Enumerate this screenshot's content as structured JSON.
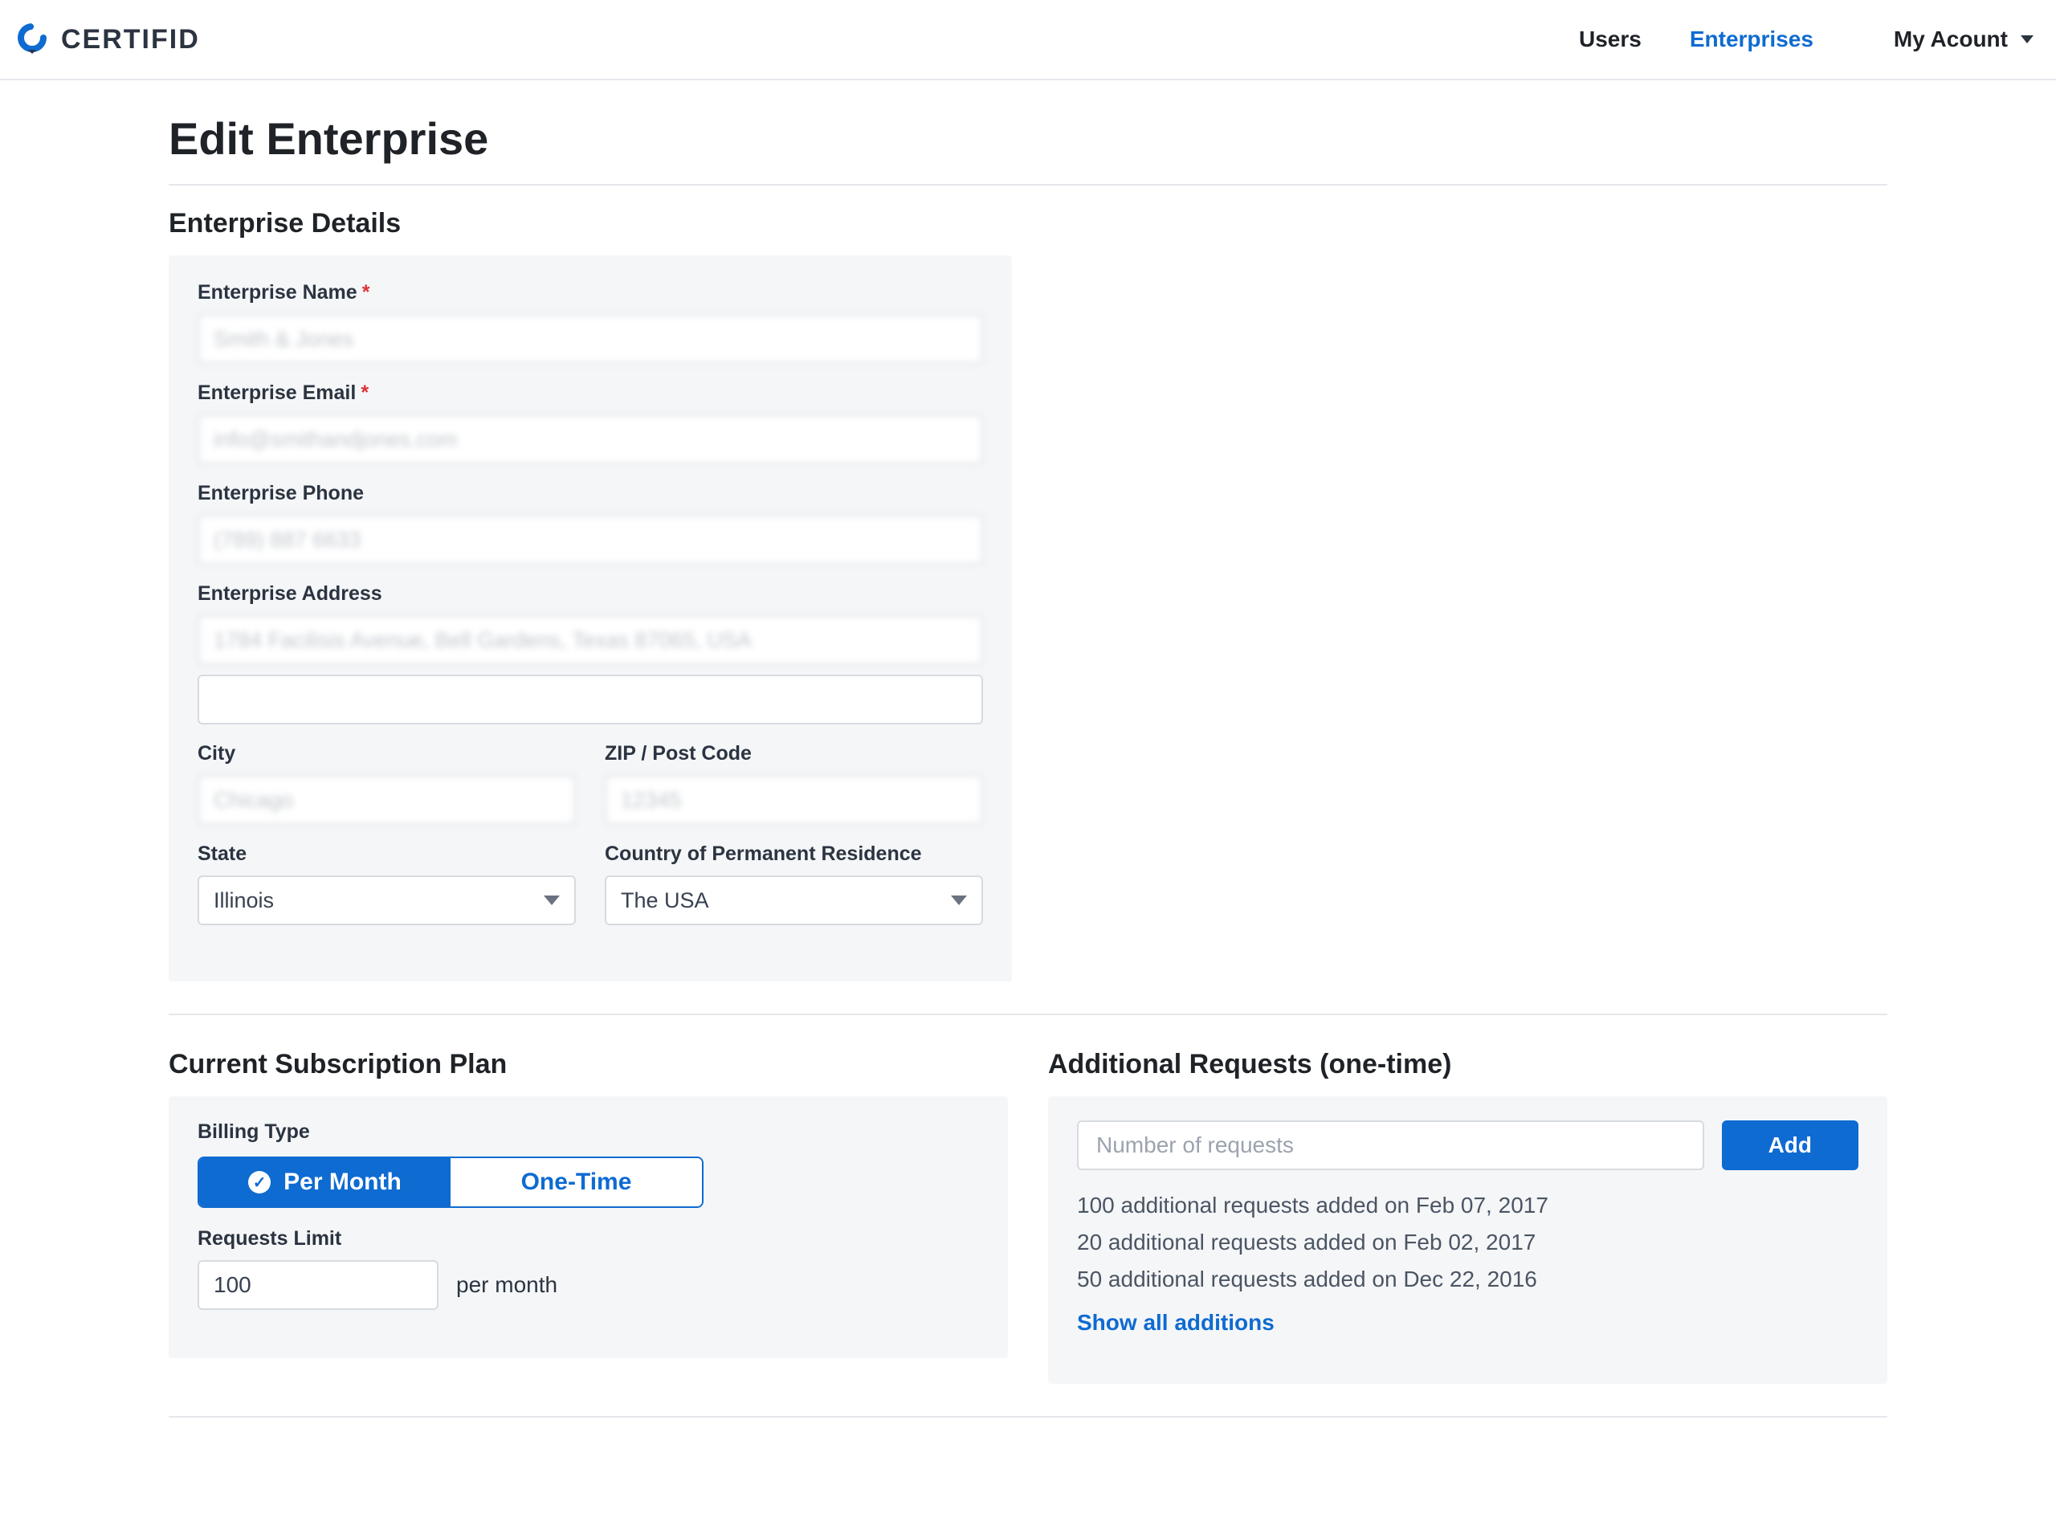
{
  "brand": {
    "name": "CERTIFID"
  },
  "nav": {
    "users": "Users",
    "enterprises": "Enterprises",
    "account": "My Acount"
  },
  "page": {
    "title": "Edit Enterprise"
  },
  "details": {
    "section_title": "Enterprise Details",
    "name_label": "Enterprise Name",
    "name_value": "Smith & Jones",
    "email_label": "Enterprise Email",
    "email_value": "info@smithandjones.com",
    "phone_label": "Enterprise Phone",
    "phone_value": "(789) 887 6633",
    "address_label": "Enterprise Address",
    "address_line1": "1784 Facilisis Avenue, Bell Gardens, Texas 87065, USA",
    "address_line2": "",
    "city_label": "City",
    "city_value": "Chicago",
    "zip_label": "ZIP / Post Code",
    "zip_value": "12345",
    "state_label": "State",
    "state_value": "Illinois",
    "country_label": "Country of Permanent Residence",
    "country_value": "The USA"
  },
  "subscription": {
    "title": "Current Subscription Plan",
    "billing_type_label": "Billing Type",
    "per_month_label": "Per Month",
    "one_time_label": "One-Time",
    "requests_limit_label": "Requests Limit",
    "requests_limit_value": "100",
    "suffix": "per month"
  },
  "additional": {
    "title": "Additional Requests (one-time)",
    "placeholder": "Number of requests",
    "add_label": "Add",
    "history": [
      "100 additional requests added on Feb 07, 2017",
      "20 additional requests added on Feb 02, 2017",
      "50 additional requests added on Dec 22, 2016"
    ],
    "show_all": "Show all additions"
  }
}
